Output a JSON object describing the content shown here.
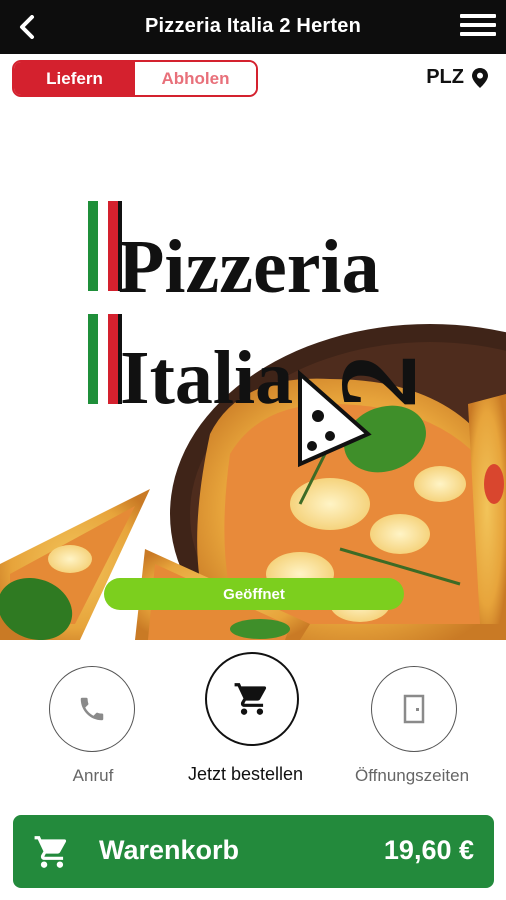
{
  "header": {
    "back_icon": "arrow-left-icon",
    "title": "Pizzeria Italia 2 Herten",
    "menu_icon": "hamburger-menu-icon"
  },
  "delivery_toggle": {
    "deliver_label": "Liefern",
    "pickup_label": "Abholen",
    "selected": "Liefern",
    "accent_color": "#d4212e"
  },
  "postcode": {
    "label": "PLZ",
    "icon": "location-pin-icon"
  },
  "hero": {
    "logo_line1": "Pizzeria",
    "logo_line2": "Italia",
    "logo_number": "2"
  },
  "status": {
    "label": "Geöffnet",
    "color": "#7ccf1e"
  },
  "actions": [
    {
      "label": "Anruf",
      "icon": "phone-icon"
    },
    {
      "label": "Jetzt bestellen",
      "icon": "shopping-cart-icon"
    },
    {
      "label": "Öffnungszeiten",
      "icon": "door-icon"
    }
  ],
  "cart": {
    "label": "Warenkorb",
    "total": "19,60 €",
    "icon": "shopping-cart-icon",
    "color": "#238a3c"
  }
}
